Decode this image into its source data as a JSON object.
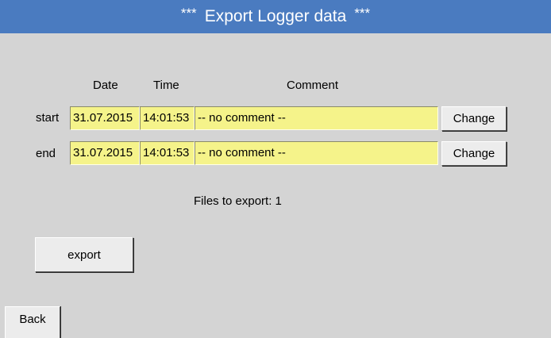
{
  "header": {
    "stars_left": "***",
    "title": "Export Logger data",
    "stars_right": "***"
  },
  "columns": {
    "date": "Date",
    "time": "Time",
    "comment": "Comment"
  },
  "rows": [
    {
      "label": "start",
      "date": "31.07.2015",
      "time": "14:01:53",
      "comment": "-- no comment --",
      "change_label": "Change"
    },
    {
      "label": "end",
      "date": "31.07.2015",
      "time": "14:01:53",
      "comment": "-- no comment --",
      "change_label": "Change"
    }
  ],
  "status": {
    "files_to_export": "Files to export:  1"
  },
  "actions": {
    "export_label": "export",
    "back_label": "Back"
  },
  "colors": {
    "title_bar": "#4a7bc0",
    "background": "#d4d4d4",
    "field": "#f5f38a",
    "button": "#ececec"
  }
}
